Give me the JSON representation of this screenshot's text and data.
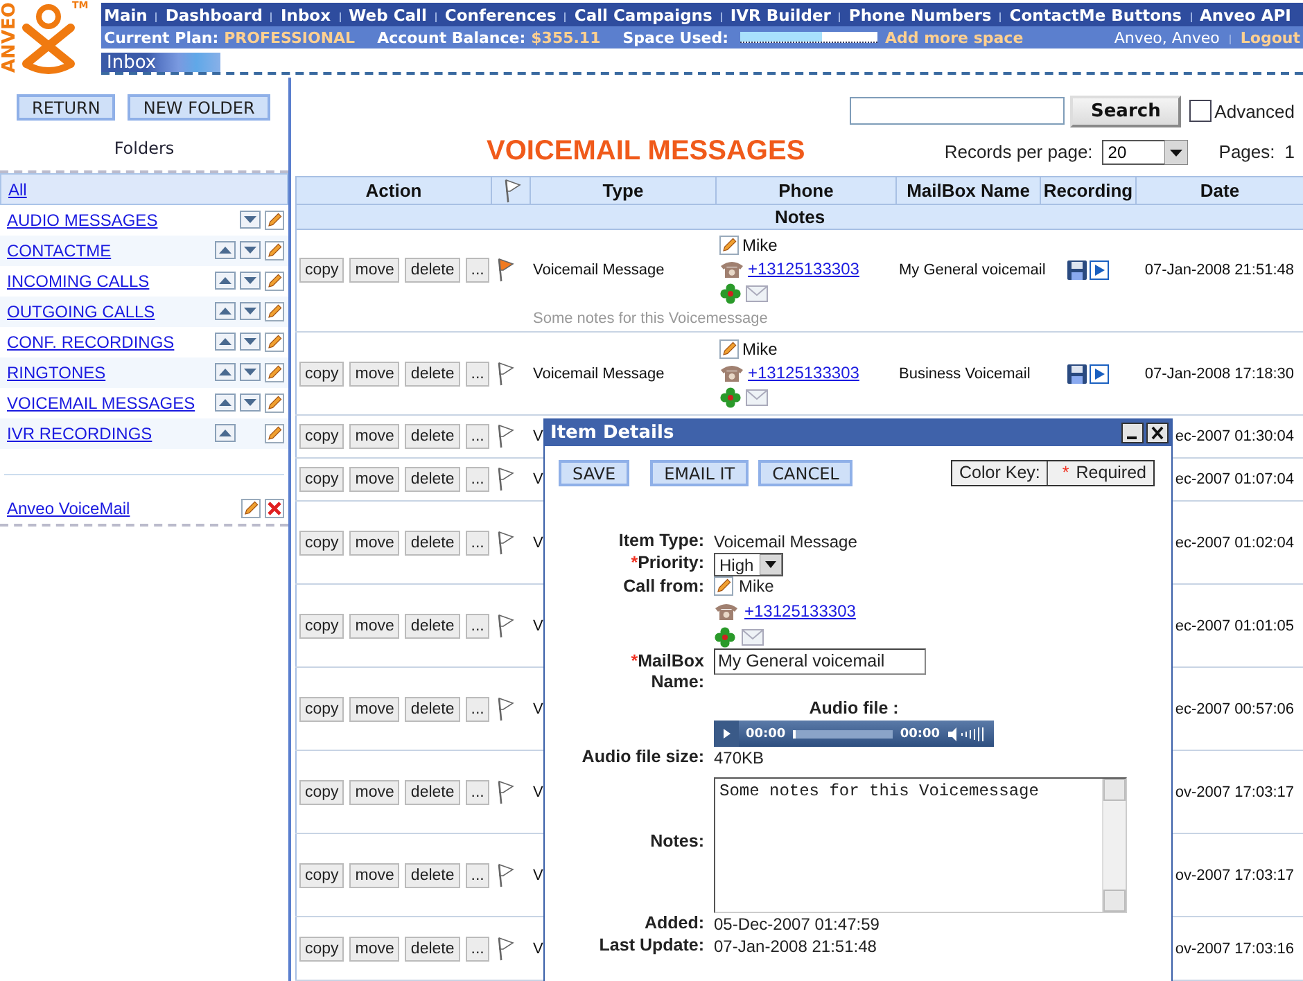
{
  "header": {
    "logo": {
      "wordmark": "ANVEO",
      "trademark": "TM"
    },
    "nav": [
      "Main",
      "Dashboard",
      "Inbox",
      "Web Call",
      "Conferences",
      "Call Campaigns",
      "IVR Builder",
      "Phone Numbers",
      "ContactMe Buttons",
      "Anveo API"
    ],
    "plan": {
      "plan_label": "Current Plan:",
      "plan": "PROFESSIONAL",
      "balance_label": "Account Balance:",
      "balance": "$355.11",
      "space_label": "Space Used:",
      "space_used": {
        "level": 0.6
      },
      "add_space": "Add more space",
      "user": "Anveo, Anveo",
      "logout": "Logout"
    },
    "tab": "Inbox"
  },
  "sidebar": {
    "buttons": [
      "RETURN",
      "NEW FOLDER"
    ],
    "title": "Folders",
    "folders": [
      {
        "label": "All",
        "selected": true,
        "can_move_up": false,
        "can_move_down": false,
        "editable": false
      },
      {
        "label": "AUDIO MESSAGES",
        "selected": false,
        "can_move_up": false,
        "can_move_down": true,
        "editable": true
      },
      {
        "label": "CONTACTME",
        "selected": false,
        "can_move_up": true,
        "can_move_down": true,
        "editable": true
      },
      {
        "label": "INCOMING CALLS",
        "selected": false,
        "can_move_up": true,
        "can_move_down": true,
        "editable": true
      },
      {
        "label": "OUTGOING CALLS",
        "selected": false,
        "can_move_up": true,
        "can_move_down": true,
        "editable": true
      },
      {
        "label": "CONF. RECORDINGS",
        "selected": false,
        "can_move_up": true,
        "can_move_down": true,
        "editable": true
      },
      {
        "label": "RINGTONES",
        "selected": false,
        "can_move_up": true,
        "can_move_down": true,
        "editable": true
      },
      {
        "label": "VOICEMAIL MESSAGES",
        "selected": false,
        "can_move_up": true,
        "can_move_down": true,
        "editable": true
      },
      {
        "label": "IVR RECORDINGS",
        "selected": false,
        "can_move_up": true,
        "can_move_down": false,
        "editable": true
      }
    ],
    "mailboxes": [
      {
        "label": "Anveo VoiceMail"
      }
    ]
  },
  "search": {
    "button": "Search",
    "advanced": {
      "label": "Advanced",
      "checked": false
    }
  },
  "title": "VOICEMAIL MESSAGES",
  "paging": {
    "records_label": "Records per page:",
    "records": "20",
    "pages_label": "Pages:",
    "pages": "1"
  },
  "table": {
    "columns": [
      {
        "kind": "text",
        "label": "Action"
      },
      {
        "kind": "flag"
      },
      {
        "kind": "text",
        "label": "Type"
      },
      {
        "kind": "text",
        "label": "Phone"
      },
      {
        "kind": "text",
        "label": "MailBox Name"
      },
      {
        "kind": "text",
        "label": "Recording"
      },
      {
        "kind": "text",
        "label": "Date"
      }
    ],
    "notes_header": "Notes",
    "rows": [
      {
        "actions": [
          "copy",
          "move",
          "delete",
          "..."
        ],
        "flagged": true,
        "type": "Voicemail Message",
        "contact": "Mike",
        "phone": "+13125133303",
        "mailbox": "My General voicemail",
        "recording": true,
        "date": "07-Jan-2008 21:51:48",
        "notes": "Some notes for this Voicemessage"
      },
      {
        "actions": [
          "copy",
          "move",
          "delete",
          "..."
        ],
        "flagged": false,
        "type": "Voicemail Message",
        "contact": "Mike",
        "phone": "+13125133303",
        "mailbox": "Business Voicemail",
        "recording": true,
        "date": "07-Jan-2008 17:18:30"
      },
      {
        "actions": [
          "copy",
          "move",
          "delete",
          "..."
        ],
        "flagged": false,
        "type": "V",
        "date": "ec-2007 01:30:04"
      },
      {
        "actions": [
          "copy",
          "move",
          "delete",
          "..."
        ],
        "flagged": false,
        "type": "V",
        "date": "ec-2007 01:07:04"
      },
      {
        "actions": [
          "copy",
          "move",
          "delete",
          "..."
        ],
        "flagged": false,
        "type": "V",
        "date": "ec-2007 01:02:04"
      },
      {
        "actions": [
          "copy",
          "move",
          "delete",
          "..."
        ],
        "flagged": false,
        "type": "V",
        "date": "ec-2007 01:01:05"
      },
      {
        "actions": [
          "copy",
          "move",
          "delete",
          "..."
        ],
        "flagged": false,
        "type": "V",
        "date": "ec-2007 00:57:06"
      },
      {
        "actions": [
          "copy",
          "move",
          "delete",
          "..."
        ],
        "flagged": false,
        "type": "V",
        "date": "ov-2007 17:03:17"
      },
      {
        "actions": [
          "copy",
          "move",
          "delete",
          "..."
        ],
        "flagged": false,
        "type": "V",
        "date": "ov-2007 17:03:17"
      },
      {
        "actions": [
          "copy",
          "move",
          "delete",
          "..."
        ],
        "flagged": false,
        "type": "V",
        "date": "ov-2007 17:03:16"
      }
    ]
  },
  "dialog": {
    "title": "Item Details",
    "buttons": [
      "SAVE",
      "EMAIL IT",
      "CANCEL"
    ],
    "required_mark": "*",
    "color_key": {
      "label": "Color Key:",
      "text": "Required"
    },
    "fields": [
      {
        "kind": "text",
        "label": "Item Type:",
        "value": "Voicemail Message",
        "required": false
      },
      {
        "kind": "select",
        "label": "Priority:",
        "value": "High",
        "required": true
      },
      {
        "kind": "contact",
        "label": "Call from:",
        "name": "Mike",
        "phone": "+13125133303",
        "required": false
      },
      {
        "kind": "input",
        "label": "MailBox Name:",
        "value": "My General voicemail",
        "required": true
      },
      {
        "kind": "audio",
        "label": "Audio file :",
        "elapsed": "00:00",
        "duration": "00:00"
      },
      {
        "kind": "text",
        "label": "Audio file size:",
        "value": "470KB",
        "required": false
      },
      {
        "kind": "textarea",
        "label": "Notes:",
        "value": "Some notes for this Voicemessage",
        "required": false
      },
      {
        "kind": "text",
        "label": "Added:",
        "value": "05-Dec-2007 01:47:59",
        "required": false
      },
      {
        "kind": "text",
        "label": "Last Update:",
        "value": "07-Jan-2008 21:51:48",
        "required": false
      }
    ]
  }
}
